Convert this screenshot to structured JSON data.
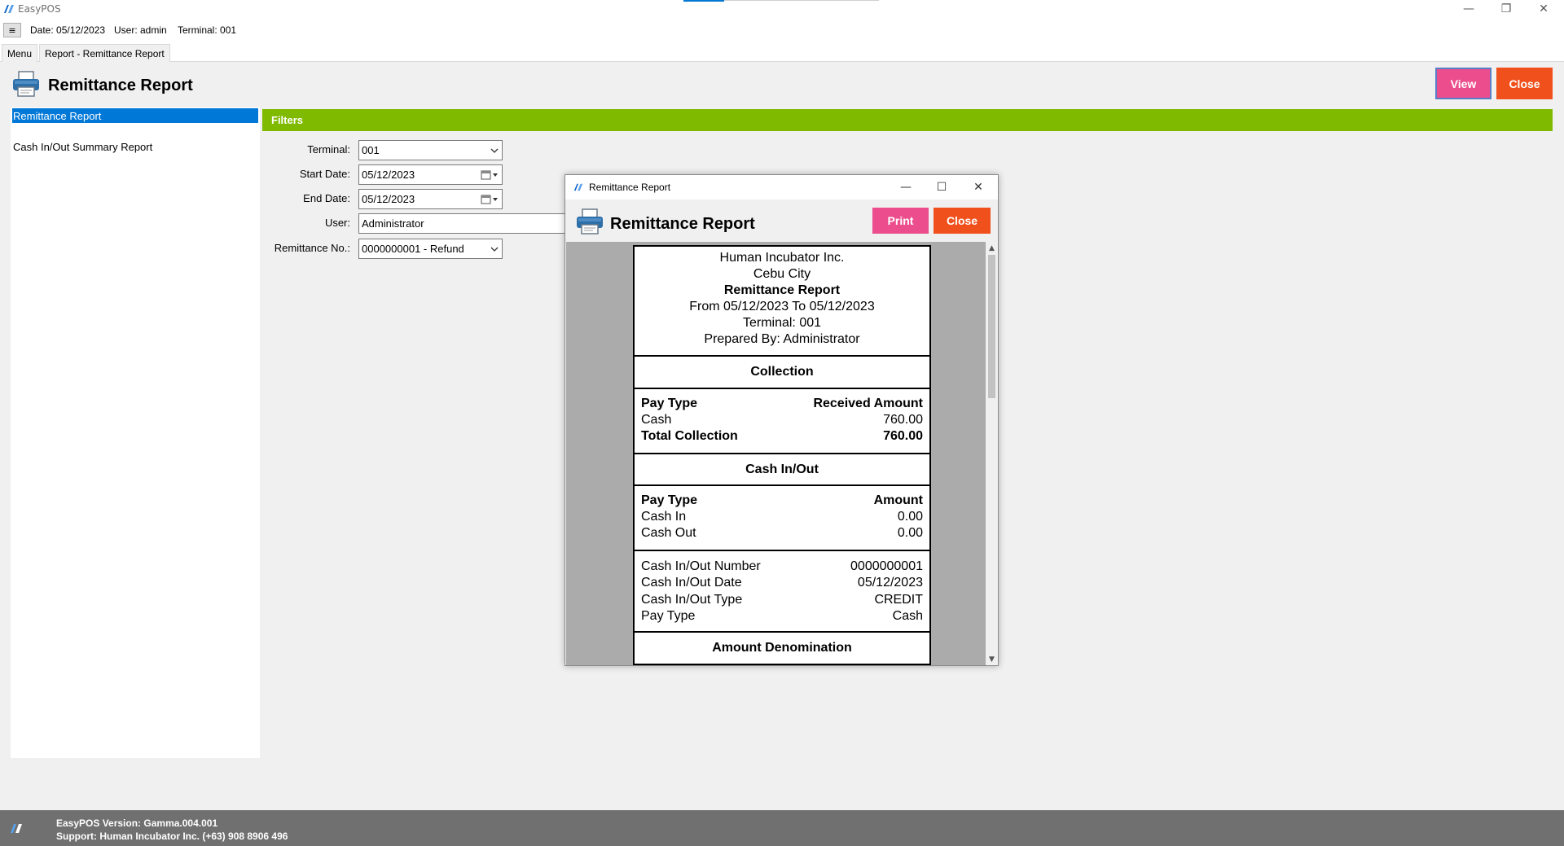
{
  "window": {
    "title": "EasyPOS",
    "minimize": "—",
    "restore": "❐",
    "close": "✕"
  },
  "info": {
    "menu_toggle": "≡",
    "date": "Date: 05/12/2023",
    "user": "User: admin",
    "terminal": "Terminal: 001"
  },
  "tabs": {
    "menu": "Menu",
    "active": "Report - Remittance Report"
  },
  "header": {
    "title": "Remittance Report",
    "view_label": "View",
    "close_label": "Close"
  },
  "left_panel": {
    "items": [
      {
        "label": "Remittance Report",
        "selected": true
      },
      {
        "label": "Cash In/Out Summary Report",
        "selected": false
      }
    ]
  },
  "filters": {
    "title": "Filters",
    "terminal_label": "Terminal:",
    "terminal_value": "001",
    "start_date_label": "Start Date:",
    "start_date_value": "05/12/2023",
    "end_date_label": "End Date:",
    "end_date_value": "05/12/2023",
    "user_label": "User:",
    "user_value": "Administrator",
    "remittance_label": "Remittance No.:",
    "remittance_value": "0000000001 - Refund"
  },
  "dialog": {
    "window_title": "Remittance Report",
    "header_title": "Remittance Report",
    "print_label": "Print",
    "close_label": "Close",
    "minimize": "—",
    "maximize": "☐",
    "close": "✕"
  },
  "report": {
    "company": "Human Incubator Inc.",
    "city": "Cebu City",
    "title": "Remittance Report",
    "period": "From 05/12/2023 To 05/12/2023",
    "terminal": "Terminal: 001",
    "prepared_by": "Prepared By: Administrator",
    "collection": {
      "heading": "Collection",
      "col1": "Pay Type",
      "col2": "Received Amount",
      "rows": [
        {
          "label": "Cash",
          "value": "760.00"
        }
      ],
      "total_label": "Total Collection",
      "total_value": "760.00"
    },
    "cash_inout": {
      "heading": "Cash In/Out",
      "col1": "Pay Type",
      "col2": "Amount",
      "rows": [
        {
          "label": "Cash In",
          "value": "0.00"
        },
        {
          "label": "Cash Out",
          "value": "0.00"
        }
      ]
    },
    "cash_detail": {
      "rows": [
        {
          "label": "Cash In/Out Number",
          "value": "0000000001"
        },
        {
          "label": "Cash In/Out Date",
          "value": "05/12/2023"
        },
        {
          "label": "Cash In/Out Type",
          "value": "CREDIT"
        },
        {
          "label": "Pay Type",
          "value": "Cash"
        }
      ]
    },
    "denomination_heading": "Amount Denomination"
  },
  "status": {
    "version": "EasyPOS Version: Gamma.004.001",
    "support": "Support: Human Incubator Inc. (+63) 908 8906 496",
    "logo_text": "Human Incubator"
  },
  "colors": {
    "view": "#ec4d8c",
    "close": "#f0501c",
    "filters_bar": "#7fba00",
    "selection": "#0078d7",
    "statusbar": "#707070"
  }
}
